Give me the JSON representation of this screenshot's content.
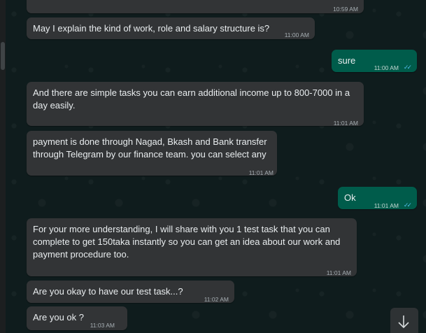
{
  "messages": [
    {
      "text": "",
      "time": "10:59 AM",
      "direction": "in"
    },
    {
      "text": "May I explain the kind of work, role and salary structure is?",
      "time": "11:00 AM",
      "direction": "in"
    },
    {
      "text": "sure",
      "time": "11:00 AM",
      "direction": "out",
      "status": "read"
    },
    {
      "lines": [
        "And there are simple tasks you can earn additional income up to 800-7000 in a",
        "day easily."
      ],
      "time": "11:01 AM",
      "direction": "in"
    },
    {
      "lines": [
        "payment is done through Nagad, Bkash and Bank transfer",
        "through Telegram by our finance team. you can select any"
      ],
      "time": "11:01 AM",
      "direction": "in"
    },
    {
      "text": "Ok",
      "time": "11:01 AM",
      "direction": "out",
      "status": "read"
    },
    {
      "lines": [
        "For your more understanding, I will share with you 1 test task that you can",
        "complete to get 150taka instantly so you can get an idea about our work and",
        "payment procedure too."
      ],
      "time": "11:01 AM",
      "direction": "in"
    },
    {
      "text": "Are you okay to have our test task...?",
      "time": "11:02 AM",
      "direction": "in"
    },
    {
      "text": "Are you ok ?",
      "time": "11:03 AM",
      "direction": "in"
    }
  ],
  "icons": {
    "read_ticks": "✓✓",
    "scroll_down": "↓"
  },
  "colors": {
    "incoming_bubble": "#323436",
    "outgoing_bubble": "#005c4b",
    "read_ticks": "#53bdeb",
    "background": "#0f1c1d"
  }
}
